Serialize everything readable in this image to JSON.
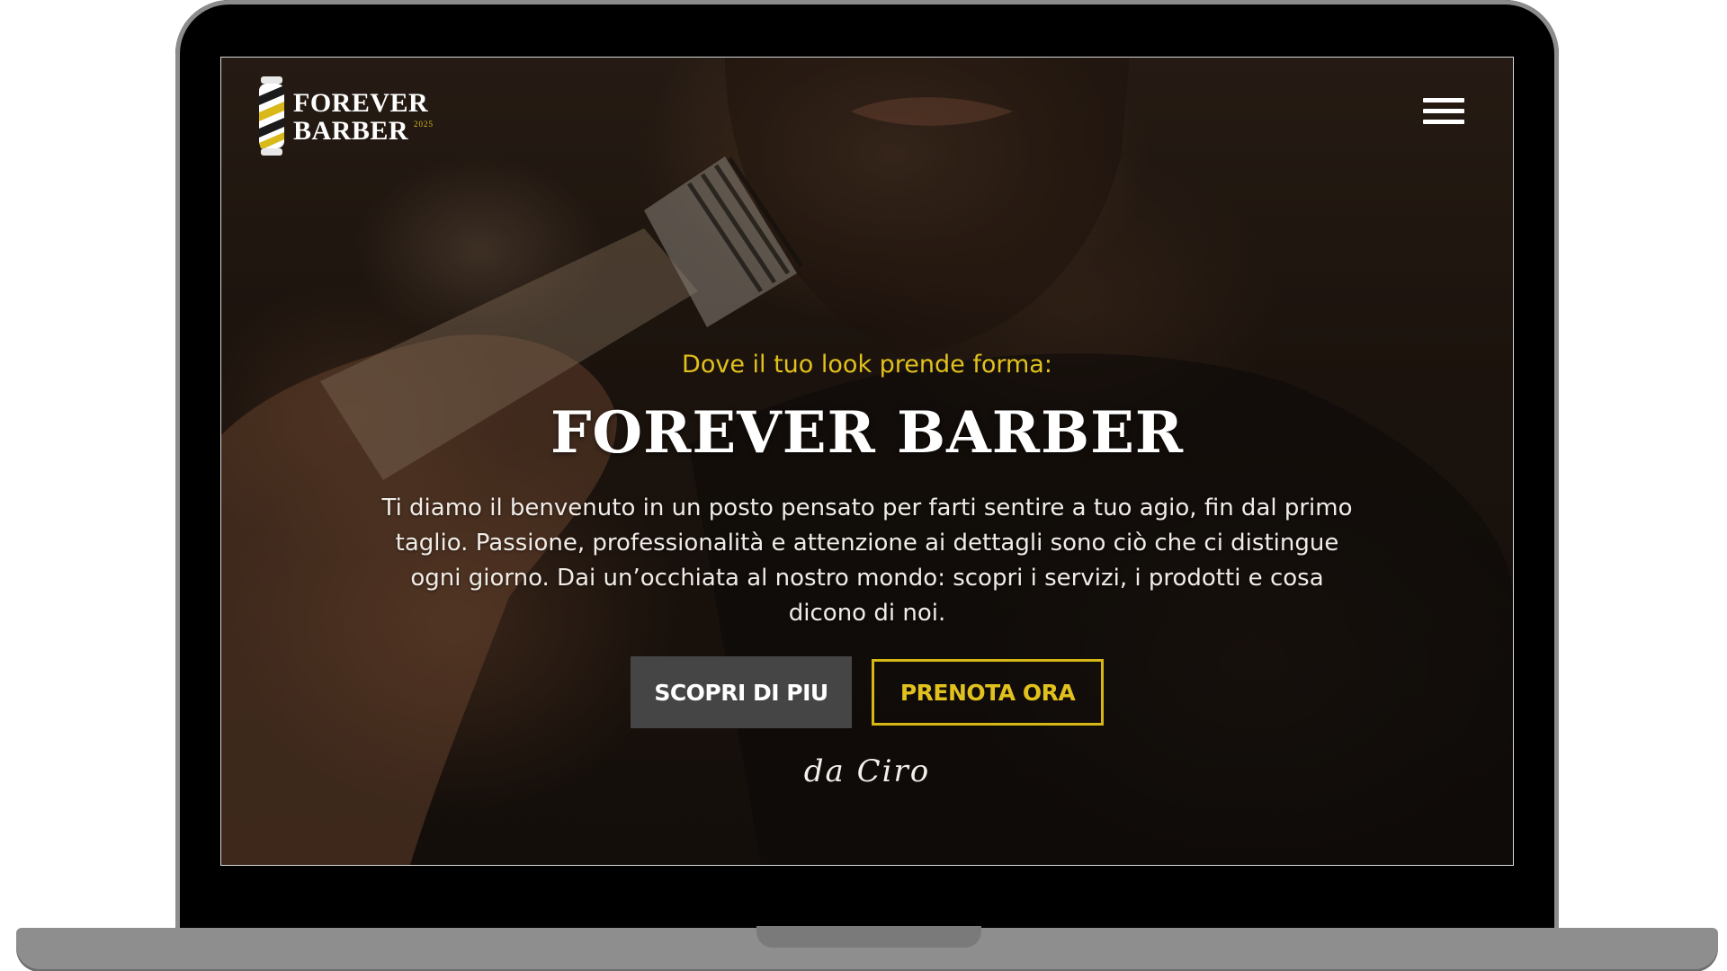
{
  "brand": {
    "logo_line1": "FOREVER",
    "logo_line2": "BARBER",
    "logo_year": "2025",
    "accent_color": "#e1c11d"
  },
  "nav": {
    "menu_icon": "hamburger-menu-icon"
  },
  "hero": {
    "eyebrow": "Dove il tuo look prende forma:",
    "title": "FOREVER BARBER",
    "body": "Ti diamo il benvenuto in un posto pensato per farti sentire a tuo agio, fin dal primo taglio. Passione, professionalità e attenzione ai dettagli sono ciò che ci distingue ogni giorno. Dai un’occhiata al nostro mondo: scopri i servizi, i prodotti e cosa dicono di noi.",
    "primary_button": "SCOPRI DI PIU",
    "secondary_button": "PRENOTA ORA",
    "signature": "da Ciro"
  }
}
